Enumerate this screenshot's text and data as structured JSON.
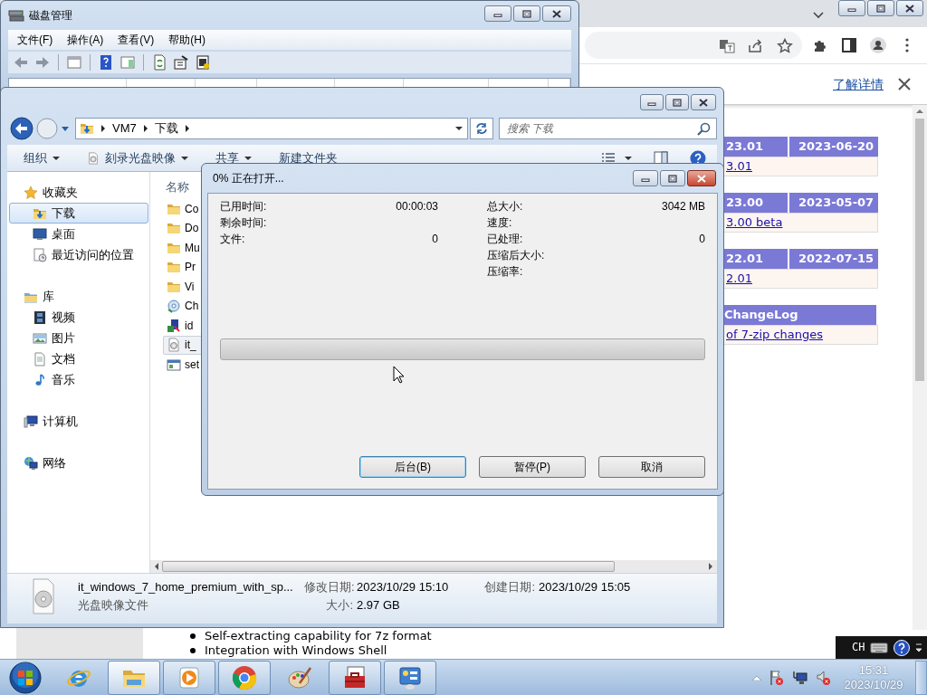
{
  "disk_management": {
    "title": "磁盘管理",
    "menu": [
      "文件(F)",
      "操作(A)",
      "查看(V)",
      "帮助(H)"
    ]
  },
  "browser": {
    "infobar": {
      "link": "了解详情"
    },
    "versions": [
      {
        "version": "23.01",
        "date": "2023-06-20",
        "link": "3.01"
      },
      {
        "version": "23.00",
        "date": "2023-05-07",
        "link": "3.00 beta"
      },
      {
        "version": "22.01",
        "date": "2022-07-15",
        "link": "2.01"
      }
    ],
    "changelog": {
      "header": "ChangeLog",
      "link": "of 7-zip changes"
    },
    "features": [
      "Self-extracting capability for 7z format",
      "Integration with Windows Shell"
    ]
  },
  "explorer": {
    "breadcrumb": [
      "VM7",
      "下载"
    ],
    "search": {
      "placeholder": "搜索 下载"
    },
    "commands": [
      {
        "label": "组织",
        "menu": true
      },
      {
        "label": "刻录光盘映像",
        "menu": true
      },
      {
        "label": "共享",
        "menu": true
      },
      {
        "label": "新建文件夹",
        "menu": false
      }
    ],
    "nav": [
      {
        "label": "收藏夹",
        "selected": false,
        "children": [
          {
            "label": "下载",
            "selected": true
          },
          {
            "label": "桌面",
            "selected": false
          },
          {
            "label": "最近访问的位置",
            "selected": false
          }
        ]
      },
      {
        "label": "库",
        "selected": false,
        "children": [
          {
            "label": "视频",
            "selected": false
          },
          {
            "label": "图片",
            "selected": false
          },
          {
            "label": "文档",
            "selected": false
          },
          {
            "label": "音乐",
            "selected": false
          }
        ]
      },
      {
        "label": "计算机",
        "selected": false
      },
      {
        "label": "网络",
        "selected": false
      }
    ],
    "column": "名称",
    "files": [
      {
        "name": "Co",
        "kind": "folder",
        "selected": false
      },
      {
        "name": "Do",
        "kind": "folder",
        "selected": false
      },
      {
        "name": "Mu",
        "kind": "folder",
        "selected": false
      },
      {
        "name": "Pr",
        "kind": "folder",
        "selected": false
      },
      {
        "name": "Vi",
        "kind": "folder",
        "selected": false
      },
      {
        "name": "Ch",
        "kind": "installer",
        "selected": false
      },
      {
        "name": "id",
        "kind": "program",
        "selected": false
      },
      {
        "name": "it_",
        "kind": "disc-image",
        "selected": true
      },
      {
        "name": "set",
        "kind": "app",
        "selected": false
      }
    ],
    "details": {
      "name": "it_windows_7_home_premium_with_sp...",
      "type": "光盘映像文件",
      "fields": [
        {
          "label": "修改日期:",
          "value": "2023/10/29 15:10"
        },
        {
          "label": "创建日期:",
          "value": "2023/10/29 15:05"
        },
        {
          "label": "大小:",
          "value": "2.97 GB"
        }
      ]
    }
  },
  "dialog": {
    "title": "0% 正在打开...",
    "stats_left": [
      {
        "label": "已用时间:",
        "value": "00:00:03"
      },
      {
        "label": "剩余时间:"
      },
      {
        "label": "文件:",
        "value": "0"
      }
    ],
    "stats_right": [
      {
        "label": "总大小:",
        "value": "3042 MB"
      },
      {
        "label": "速度:"
      },
      {
        "label": "已处理:",
        "value": "0"
      },
      {
        "label": "压缩后大小:"
      },
      {
        "label": "压缩率:"
      }
    ],
    "progress": {
      "level": 0
    },
    "buttons": [
      {
        "label": "后台(B)",
        "default": true
      },
      {
        "label": "暂停(P)",
        "default": false
      },
      {
        "label": "取消",
        "default": false
      }
    ]
  },
  "taskbar": {
    "apps": [
      {
        "running": false,
        "selected": false
      },
      {
        "running": true,
        "selected": true
      },
      {
        "running": true,
        "selected": false
      },
      {
        "running": true,
        "selected": false
      },
      {
        "running": false,
        "selected": false
      },
      {
        "running": true,
        "selected": false
      },
      {
        "running": true,
        "selected": false
      }
    ],
    "language_bar": {
      "label": "CH"
    },
    "clock": {
      "time": "15:31",
      "date": "2023/10/29"
    }
  }
}
